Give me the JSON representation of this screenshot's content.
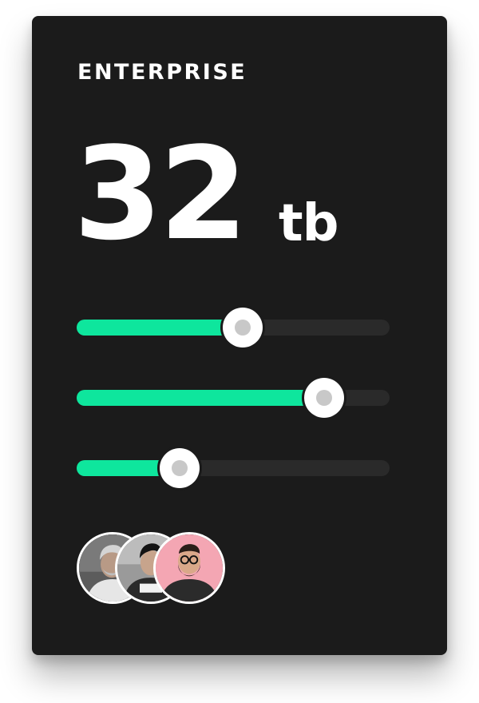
{
  "plan": {
    "name": "ENTERPRISE",
    "storage_value": "32",
    "storage_unit": "tb"
  },
  "sliders": [
    {
      "name": "slider-1",
      "fraction": 0.53
    },
    {
      "name": "slider-2",
      "fraction": 0.79
    },
    {
      "name": "slider-3",
      "fraction": 0.33
    }
  ],
  "team": {
    "avatars": [
      "avatar-person-grey-hair",
      "avatar-person-dark-hair",
      "avatar-person-bearded-glasses"
    ]
  },
  "colors": {
    "card_background": "#1b1b1b",
    "track": "#2a2a2a",
    "accent": "#0ee69d",
    "thumb": "#ffffff",
    "thumb_dot": "#c8c8c8"
  }
}
